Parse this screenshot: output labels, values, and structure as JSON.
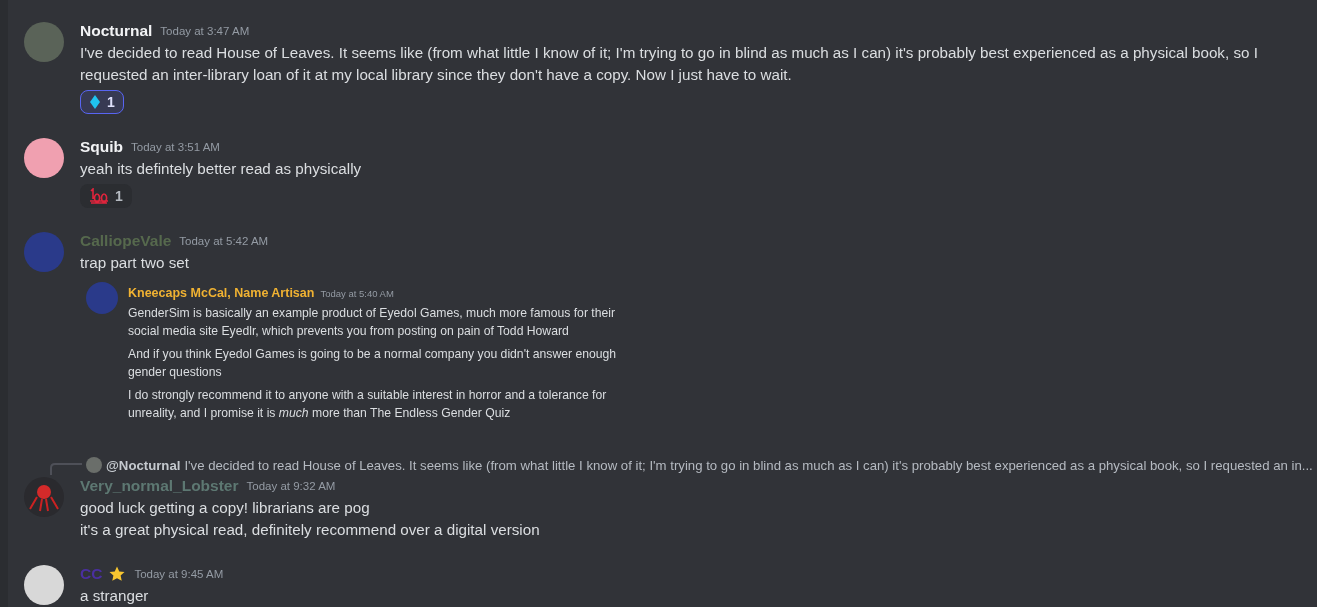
{
  "messages": [
    {
      "author": {
        "name": "Nocturnal",
        "color": "#f2f3f5"
      },
      "avatar": {
        "kind": "forest"
      },
      "badge": false,
      "time": "Today at 3:47 AM",
      "lines": [
        "I've decided to read House of Leaves. It seems like (from what little I know of it; I'm trying to go in blind as much as I can) it's probably best experienced as a physical book, so I requested an inter-library loan of it at my local library since they don't have a copy. Now I just have to wait."
      ],
      "reactions": [
        {
          "kind": "diamond",
          "count": "1",
          "selected": true
        }
      ]
    },
    {
      "author": {
        "name": "Squib",
        "color": "#f2f3f5"
      },
      "avatar": {
        "kind": "pink"
      },
      "badge": false,
      "time": "Today at 3:51 AM",
      "lines": [
        "yeah its defintely better read as physically"
      ],
      "reactions": [
        {
          "kind": "hundred",
          "count": "1",
          "selected": false
        }
      ]
    },
    {
      "author": {
        "name": "CalliopeVale",
        "color": "#56694d"
      },
      "avatar": {
        "kind": "blue"
      },
      "badge": false,
      "time": "Today at 5:42 AM",
      "lines": [
        "trap part two set"
      ],
      "embed": {
        "author": {
          "name": "Kneecaps McCal, Name Artisan",
          "color": "#f0b232"
        },
        "time": "Today at 5:40 AM",
        "lines": [
          "GenderSim is basically an example product of Eyedol Games, much more famous for their social media site Eyedlr, which prevents you from posting on pain of Todd Howard",
          "And if you think Eyedol Games is going to be a normal company you didn't answer enough gender questions",
          "I do strongly recommend it to anyone with a suitable interest in horror and a tolerance for unreality, and I promise it is *much* more than The Endless Gender Quiz"
        ]
      }
    },
    {
      "reply": {
        "author": "@Nocturnal",
        "text": "I've decided to read House of Leaves. It seems like (from what little I know of it; I'm trying to go in blind as much as I can) it's probably best experienced as a physical book, so I requested an in..."
      },
      "author": {
        "name": "Very_normal_Lobster",
        "color": "#5d7872"
      },
      "avatar": {
        "kind": "red"
      },
      "badge": false,
      "time": "Today at 9:32 AM",
      "lines": [
        "good luck getting a copy! librarians are pog",
        "it's a great physical read, definitely recommend over a digital version"
      ]
    },
    {
      "author": {
        "name": "CC",
        "color": "#4a2fa0"
      },
      "avatar": {
        "kind": "white"
      },
      "badge": true,
      "time": "Today at 9:45 AM",
      "lines": [
        "a stranger"
      ]
    }
  ]
}
